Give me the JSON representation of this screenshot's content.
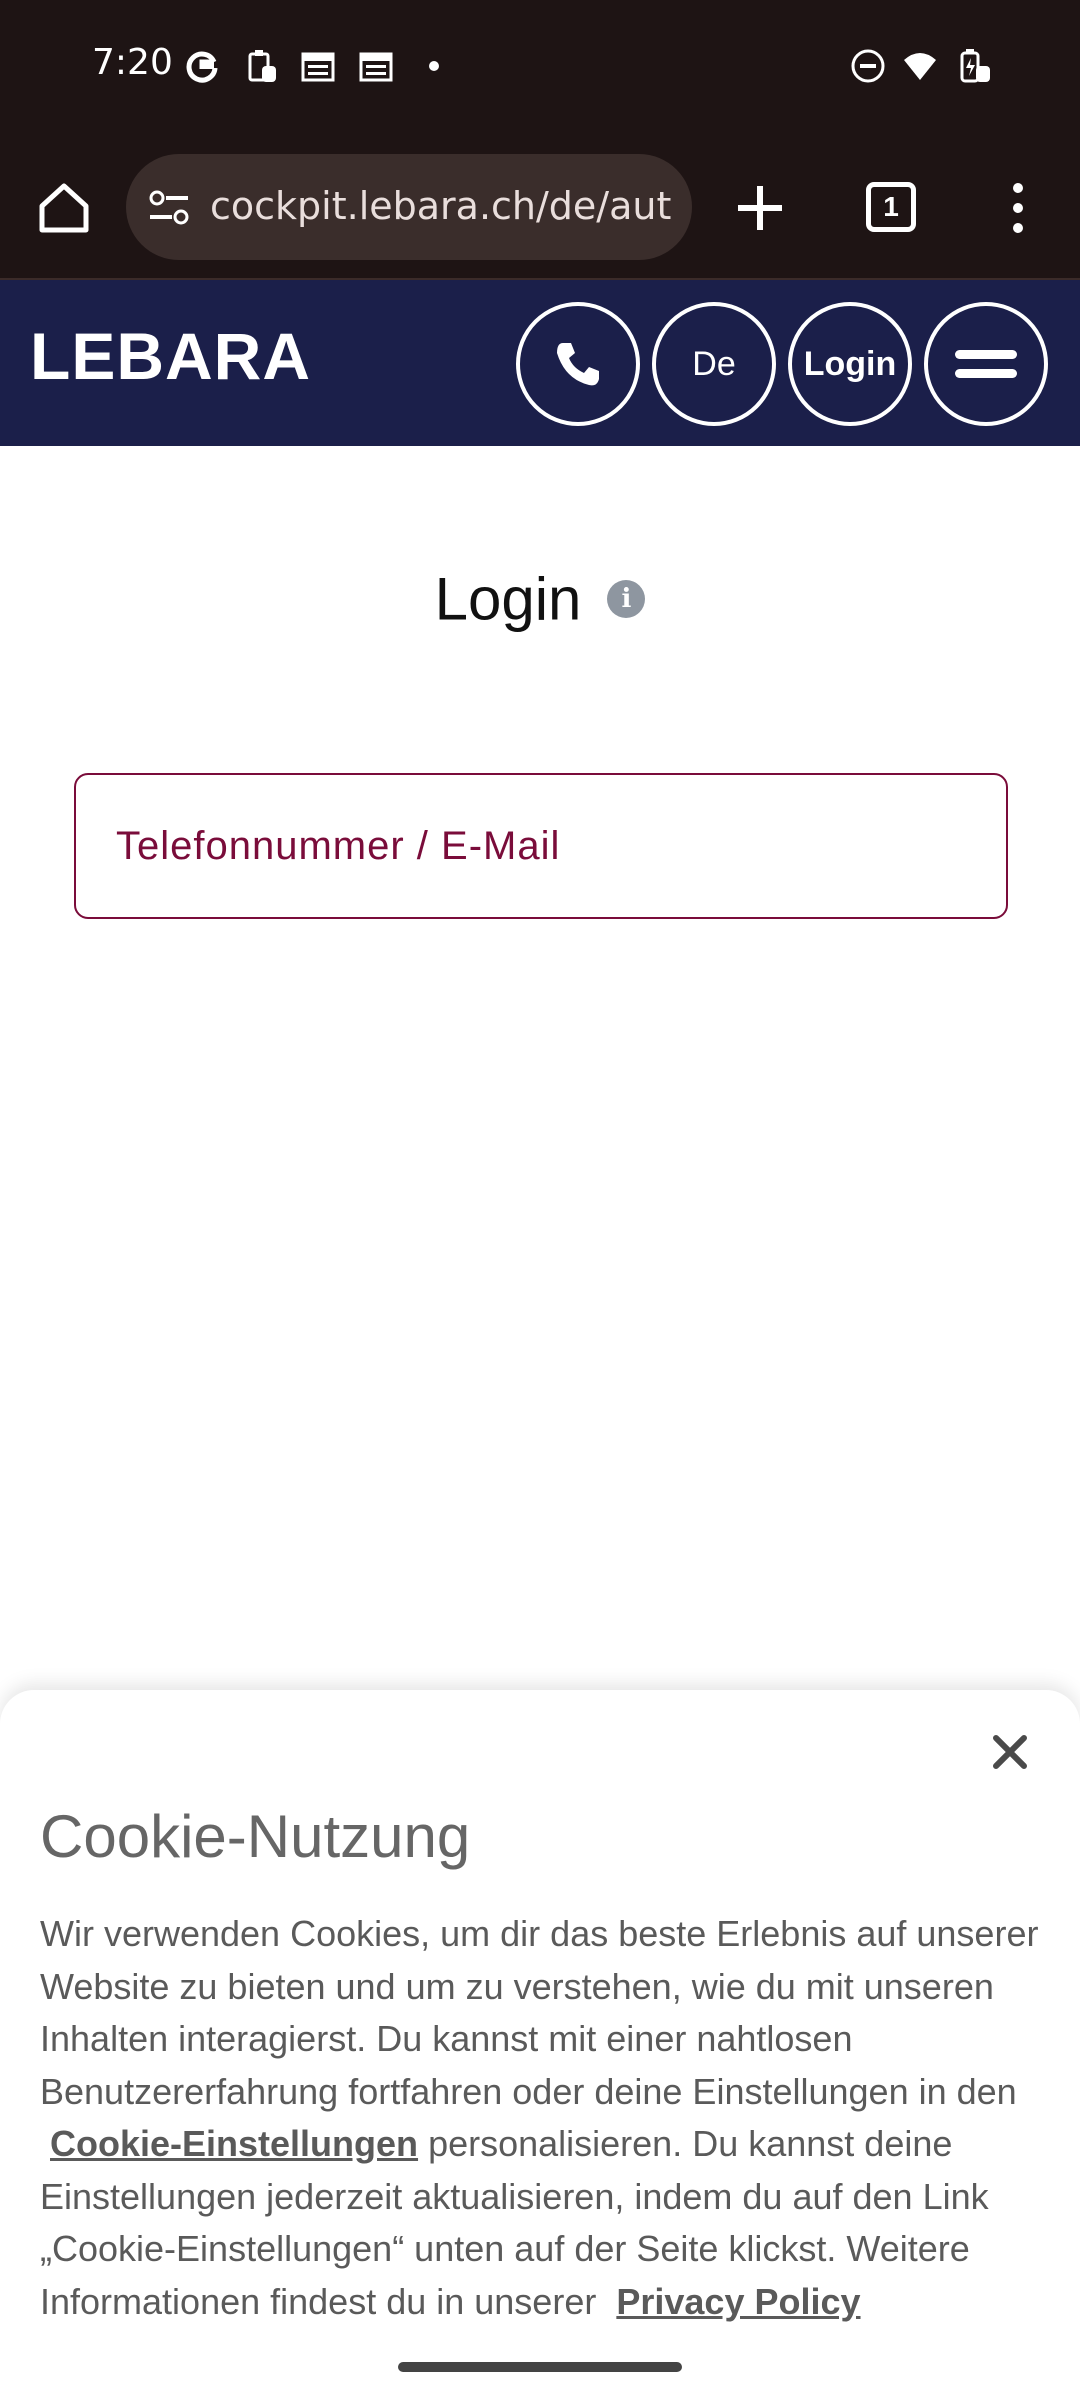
{
  "status_bar": {
    "time": "7:20",
    "left_icons": [
      "google-g-icon",
      "clipboard-icon",
      "calendar-icon",
      "calendar-icon",
      "dot-icon"
    ],
    "right_icons": [
      "do-not-disturb-icon",
      "wifi-icon",
      "battery-charging-icon"
    ]
  },
  "browser": {
    "url": "cockpit.lebara.ch/de/aut",
    "tab_count": "1",
    "icons": [
      "home-icon",
      "site-settings-icon",
      "new-tab-icon",
      "tabs-icon",
      "more-icon"
    ]
  },
  "site_header": {
    "logo": "LEBARA",
    "language": "De",
    "login": "Login",
    "icons": [
      "phone-icon",
      "menu-icon"
    ]
  },
  "login_page": {
    "title": "Login",
    "info_symbol": "i",
    "identifier_placeholder": "Telefonnummer / E-Mail"
  },
  "cookie_banner": {
    "title": "Cookie-Nutzung",
    "text_part1": "Wir verwenden Cookies, um dir das beste Erlebnis auf unserer Website zu bieten und um zu verstehen, wie du mit unseren Inhalten interagierst. Du kannst mit einer nahtlosen Benutzererfahrung fortfahren oder deine Einstellungen in den",
    "settings_link": "Cookie-Einstellungen",
    "text_part2": "personalisieren. Du kannst deine Einstellungen jederzeit aktualisieren, indem du auf den Link „Cookie-Einstellungen“ unten auf der Seite klickst. Weitere Informationen findest du in unserer",
    "privacy_link": "Privacy Policy"
  },
  "colors": {
    "browser_bg": "#1e1414",
    "header_bg": "#1b1f4a",
    "accent": "#7a0c3a"
  }
}
